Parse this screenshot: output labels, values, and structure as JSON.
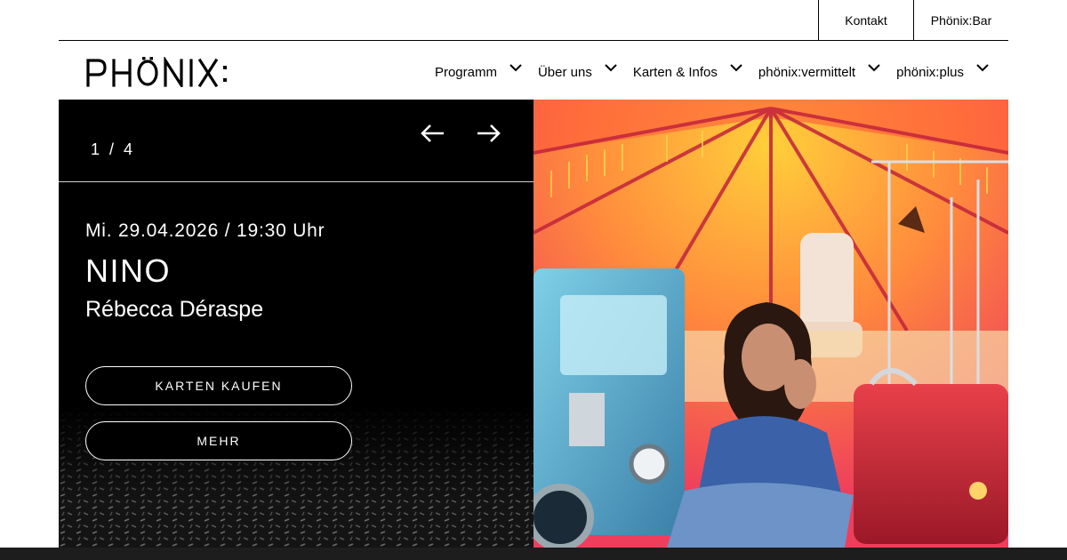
{
  "utility_links": [
    {
      "label": "Kontakt"
    },
    {
      "label": "Phönix:Bar"
    }
  ],
  "logo": {
    "text": "PHÖNIX:"
  },
  "nav": [
    {
      "label": "Programm"
    },
    {
      "label": "Über uns"
    },
    {
      "label": "Karten & Infos"
    },
    {
      "label": "phönix:vermittelt"
    },
    {
      "label": "phönix:plus"
    }
  ],
  "hero": {
    "counter": "1 / 4",
    "date": "Mi. 29.04.2026  /  19:30 Uhr",
    "title": "NINO",
    "subtitle": "Rébecca Déraspe",
    "buy_label": "KARTEN KAUFEN",
    "more_label": "MEHR"
  },
  "colors": {
    "background": "#ffffff",
    "panel": "#000000",
    "text_light": "#ffffff",
    "strip": "#1d1d1d"
  },
  "icons": {
    "prev": "arrow-left-icon",
    "next": "arrow-right-icon",
    "chevron": "chevron-down-icon"
  }
}
